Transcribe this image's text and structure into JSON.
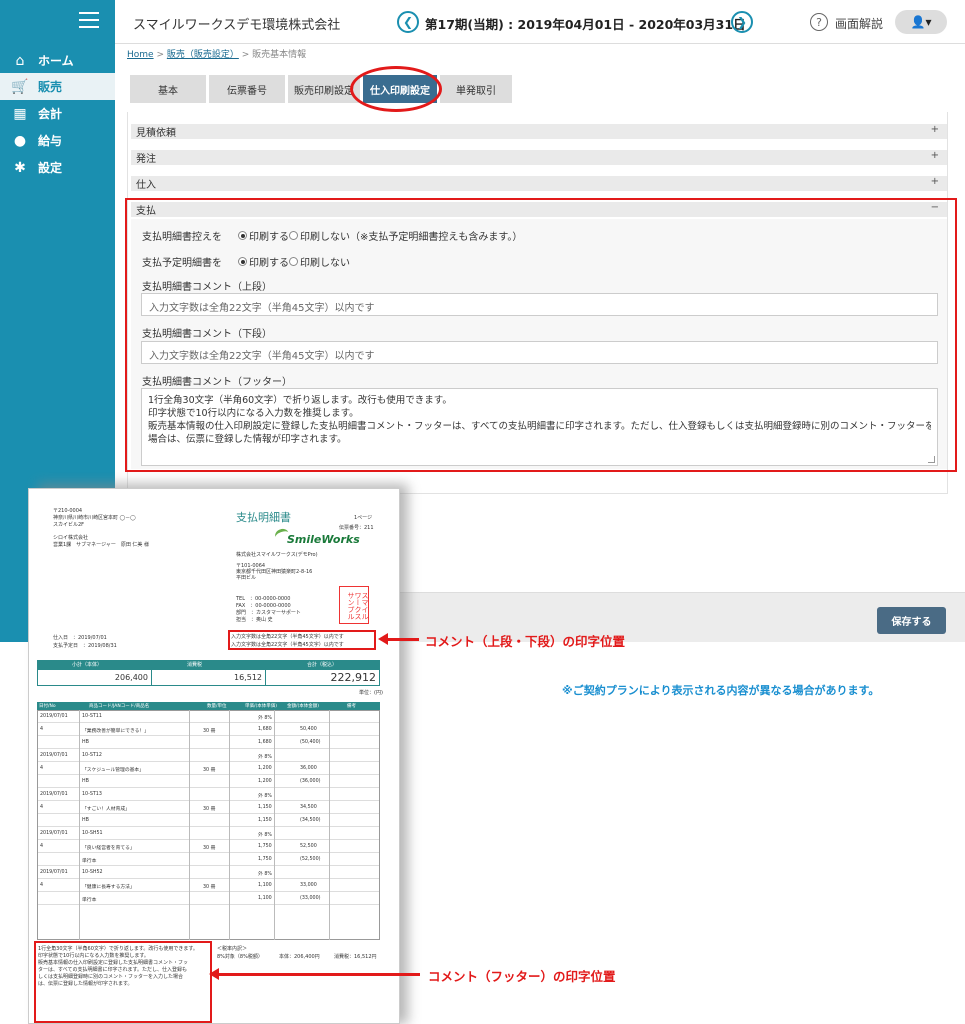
{
  "header": {
    "company": "スマイルワークスデモ環境株式会社",
    "period": "第17期(当期) : 2019年04月01日 - 2020年03月31日",
    "help_label": "画面解説"
  },
  "sidebar": {
    "items": [
      {
        "label": "ホーム"
      },
      {
        "label": "販売"
      },
      {
        "label": "会計"
      },
      {
        "label": "給与"
      },
      {
        "label": "設定"
      }
    ]
  },
  "breadcrumb": {
    "home": "Home",
    "sales": "販売（販売設定）",
    "current": "販売基本情報"
  },
  "tabs": [
    "基本",
    "伝票番号",
    "販売印刷設定",
    "仕入印刷設定",
    "単発取引"
  ],
  "sections": {
    "quote": "見積依頼",
    "order": "発注",
    "purchase": "仕入",
    "payment": "支払"
  },
  "payment": {
    "receipt_copy_label": "支払明細書控えを",
    "receipt_copy_on": "印刷する",
    "receipt_copy_off": "印刷しない（※支払予定明細書控えも含みます。）",
    "schedule_label": "支払予定明細書を",
    "schedule_on": "印刷する",
    "schedule_off": "印刷しない",
    "comment_upper_label": "支払明細書コメント（上段）",
    "comment_upper_placeholder": "入力文字数は全角22文字（半角45文字）以内です",
    "comment_lower_label": "支払明細書コメント（下段）",
    "comment_lower_placeholder": "入力文字数は全角22文字（半角45文字）以内です",
    "comment_footer_label": "支払明細書コメント（フッター）",
    "comment_footer_lines": [
      "1行全角30文字（半角60文字）で折り返します。改行も使用できます。",
      "印字状態で10行以内になる入力数を推奨します。",
      "販売基本情報の仕入印刷設定に登録した支払明細書コメント・フッターは、すべての支払明細書に印字されます。ただし、仕入登録もしくは支払明細登録時に別のコメント・フッターを入力した",
      "場合は、伝票に登録した情報が印字されます。"
    ]
  },
  "save_label": "保存する",
  "note": "※ご契約プランにより表示される内容が異なる場合があります。",
  "annotations": {
    "upper_lower": "コメント（上段・下段）の印字位置",
    "footer": "コメント（フッター）の印字位置"
  },
  "paper": {
    "title": "支払明細書",
    "page": "1ページ",
    "slip_no": "伝票番号：211",
    "logo": "SmileWorks",
    "issuer": "株式会社スマイルワークス(デモPro)",
    "issuer_zip": "〒101-0064",
    "issuer_addr": "東京都千代田区神田猿楽町2-8-16",
    "issuer_bldg": "平田ビル",
    "tel": "TEL　：00-0000-0000",
    "fax": "FAX　：00-0000-0000",
    "dept": "部門　：カスタマーサポート",
    "person": "担当　：奥山 史",
    "stamp": "スマイルワークスサンプル",
    "to_zip": "〒210-0004",
    "to_addr": "神奈川県川崎市川崎区宮本町 ◯－◯",
    "to_bldg": "スカイビル2F",
    "to_company": "シロイ株式会社",
    "to_person": "営業1課　サブマネージャー　原田 仁美 様",
    "purchase_date": "仕入日　：2019/07/01",
    "pay_date": "支払予定日　：2019/08/31",
    "comment1": "入力文字数は全角22文字（半角45文字）以内です",
    "comment2": "入力文字数は全角22文字（半角45文字）以内です",
    "totals_head": [
      "小計（本体）",
      "消費税",
      "合計（税込）"
    ],
    "totals": [
      "206,400",
      "16,512",
      "222,912"
    ],
    "unit": "単位：(円)",
    "table_head": [
      "日付/No",
      "商品コード/JANコード/商品名",
      "数量/単位",
      "単価/(本体単価)",
      "金額/(本体金額)",
      "備考"
    ],
    "rows": [
      [
        "2019/07/01",
        "10-ST11",
        "",
        "外 8%",
        "",
        ""
      ],
      [
        "4",
        "「業務改善が簡単にできる！」",
        "30 冊",
        "1,680",
        "50,400",
        ""
      ],
      [
        "",
        "HB",
        "",
        "1,680",
        "(50,400)",
        ""
      ],
      [
        "2019/07/01",
        "10-ST12",
        "",
        "外 8%",
        "",
        ""
      ],
      [
        "4",
        "「スケジュール管理の基本」",
        "30 冊",
        "1,200",
        "36,000",
        ""
      ],
      [
        "",
        "HB",
        "",
        "1,200",
        "(36,000)",
        ""
      ],
      [
        "2019/07/01",
        "10-ST13",
        "",
        "外 8%",
        "",
        ""
      ],
      [
        "4",
        "「すごい！人材育成」",
        "30 冊",
        "1,150",
        "34,500",
        ""
      ],
      [
        "",
        "HB",
        "",
        "1,150",
        "(34,500)",
        ""
      ],
      [
        "2019/07/01",
        "10-SH51",
        "",
        "外 8%",
        "",
        ""
      ],
      [
        "4",
        "「良い経営者を育てる」",
        "30 冊",
        "1,750",
        "52,500",
        ""
      ],
      [
        "",
        "単行本",
        "",
        "1,750",
        "(52,500)",
        ""
      ],
      [
        "2019/07/01",
        "10-SH52",
        "",
        "外 8%",
        "",
        ""
      ],
      [
        "4",
        "「健康に長寿する方法」",
        "30 冊",
        "1,100",
        "33,000",
        ""
      ],
      [
        "",
        "単行本",
        "",
        "1,100",
        "(33,000)",
        ""
      ]
    ],
    "footer_text": [
      "1行全角30文字（半角60文字）で折り返します。改行も使用できます。",
      "印字状態で10行以内になる入力数を推奨します。",
      "販売基本情報の仕入印刷設定に登録した支払明細書コメント・フッ",
      "ターは、すべての支払明細書に印字されます。ただし、仕入登録も",
      "しくは支払明細登録時に別のコメント・フッターを入力した場合",
      "は、伝票に登録した情報が印字されます。"
    ],
    "summary_tax": "＜税率内訳＞",
    "summary_rate": "8%対象（8%税額）",
    "summary_body": "本体：206,400円",
    "summary_tax_amt": "消費税：16,512円"
  }
}
